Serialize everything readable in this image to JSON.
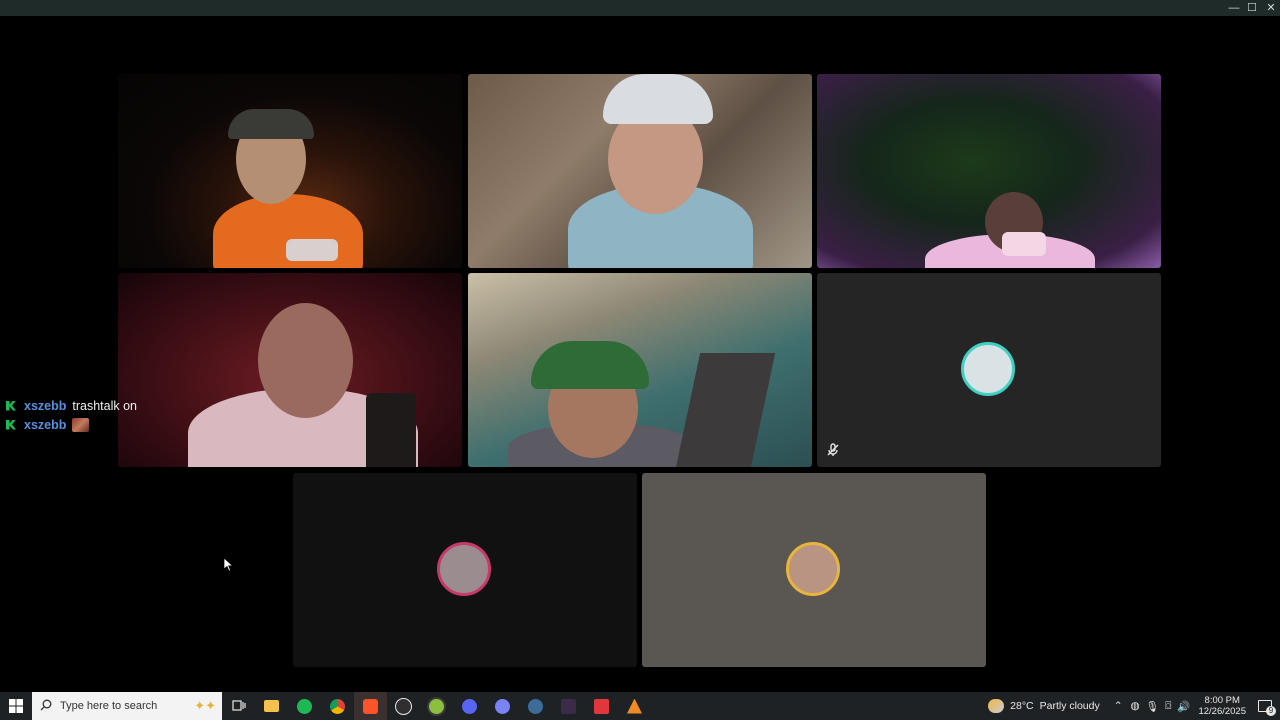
{
  "window": {
    "minimize_glyph": "—",
    "maximize_glyph": "☐",
    "close_glyph": "✕"
  },
  "chat": {
    "messages": [
      {
        "user": "xszebb",
        "text": "trashtalk on"
      },
      {
        "user": "xszebb",
        "text": ""
      }
    ]
  },
  "taskbar": {
    "search_placeholder": "Type here to search",
    "apps": [
      "task-view",
      "file-explorer",
      "spotify",
      "chrome",
      "brave",
      "obs",
      "app-green",
      "discord-alt",
      "discord",
      "steam",
      "app-dark",
      "app-red",
      "app-orange"
    ],
    "weather": {
      "temp": "28°C",
      "condition": "Partly cloudy"
    },
    "time": "8:00 PM",
    "date": "12/26/2025",
    "notification_count": "9"
  }
}
